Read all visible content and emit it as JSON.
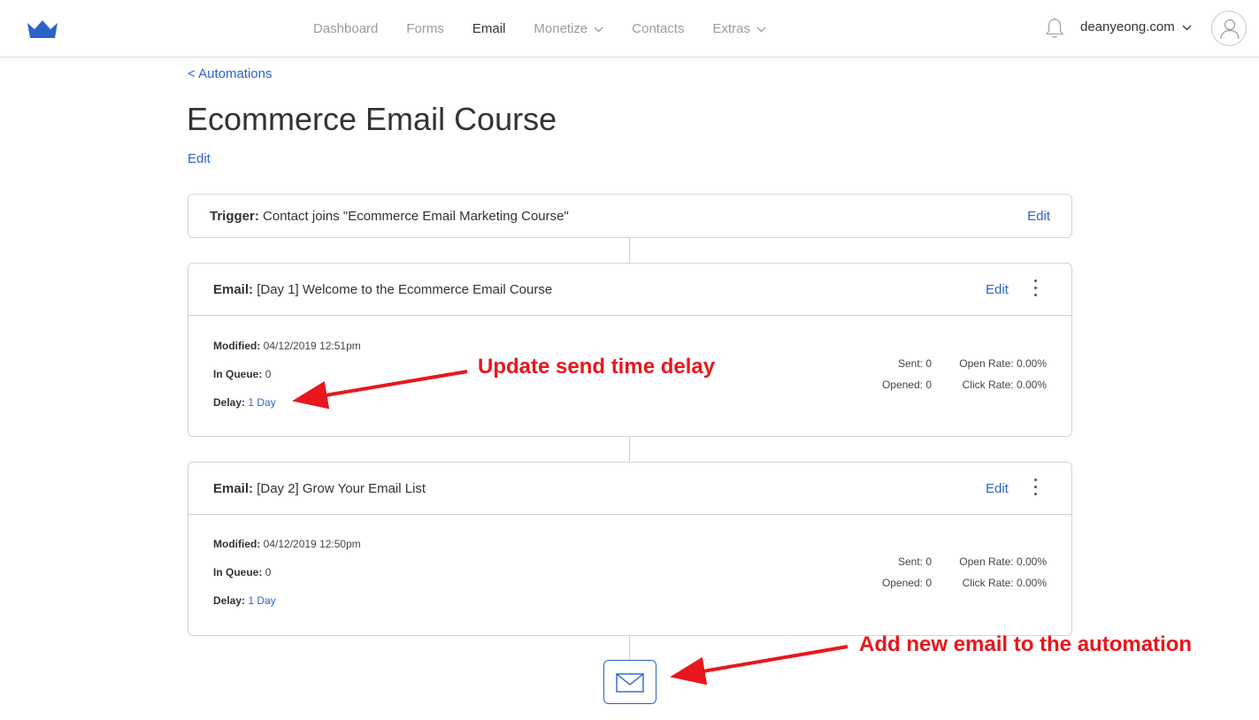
{
  "nav": {
    "items": [
      {
        "label": "Dashboard",
        "active": false,
        "dropdown": false
      },
      {
        "label": "Forms",
        "active": false,
        "dropdown": false
      },
      {
        "label": "Email",
        "active": true,
        "dropdown": false
      },
      {
        "label": "Monetize",
        "active": false,
        "dropdown": true
      },
      {
        "label": "Contacts",
        "active": false,
        "dropdown": false
      },
      {
        "label": "Extras",
        "active": false,
        "dropdown": true
      }
    ],
    "account_label": "deanyeong.com"
  },
  "page": {
    "back_link": "< Automations",
    "title": "Ecommerce Email Course",
    "edit_label": "Edit"
  },
  "trigger": {
    "label": "Trigger:",
    "text": "Contact joins \"Ecommerce Email Marketing Course\"",
    "edit_label": "Edit"
  },
  "emails": [
    {
      "label": "Email:",
      "subject": "[Day 1] Welcome to the Ecommerce Email Course",
      "edit_label": "Edit",
      "modified_label": "Modified:",
      "modified": "04/12/2019 12:51pm",
      "queue_label": "In Queue:",
      "queue": "0",
      "delay_label": "Delay:",
      "delay": "1 Day",
      "sent": "Sent: 0",
      "opened": "Opened: 0",
      "open_rate": "Open Rate: 0.00%",
      "click_rate": "Click Rate: 0.00%"
    },
    {
      "label": "Email:",
      "subject": "[Day 2] Grow Your Email List",
      "edit_label": "Edit",
      "modified_label": "Modified:",
      "modified": "04/12/2019 12:50pm",
      "queue_label": "In Queue:",
      "queue": "0",
      "delay_label": "Delay:",
      "delay": "1 Day",
      "sent": "Sent: 0",
      "opened": "Opened: 0",
      "open_rate": "Open Rate: 0.00%",
      "click_rate": "Click Rate: 0.00%"
    }
  ],
  "annotations": {
    "delay_note": "Update send time delay",
    "add_note": "Add new email to the automation"
  },
  "colors": {
    "brand": "#2d63c8",
    "annotation": "#e8171d"
  },
  "icons": {
    "logo": "crown-icon",
    "notifications": "bell-icon",
    "avatar": "user-icon",
    "add_email": "envelope-icon"
  }
}
